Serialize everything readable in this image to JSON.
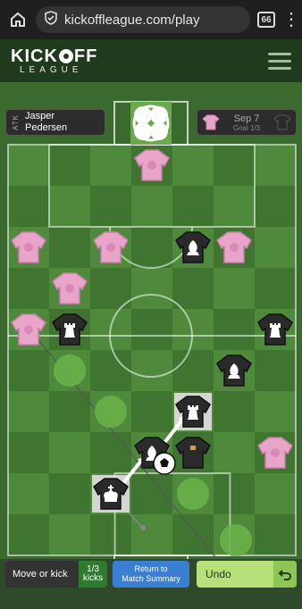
{
  "browser": {
    "url": "kickoffleague.com/play",
    "tab_count": "66"
  },
  "header": {
    "logo_main_a": "KICK",
    "logo_main_b": "FF",
    "logo_sub": "LEAGUE"
  },
  "match": {
    "attacker_tag": "ATK",
    "player_name_line1": "Jasper",
    "player_name_line2": "Pedersen",
    "date": "Sep 7",
    "goal_progress": "Goal 1/3"
  },
  "controls": {
    "move_label": "Move or kick",
    "kick_count": "1/3",
    "kick_unit": "kicks",
    "summary_line1": "Return to",
    "summary_line2": "Match Summary",
    "undo_label": "Undo"
  },
  "colors": {
    "pink_team": "#e8a5c9",
    "black_team": "#2a2a2a",
    "pitch_light": "#4f8a3c",
    "pitch_dark": "#3f7530",
    "accent_green": "#b5e07a",
    "summary_blue": "#3a7fd1"
  },
  "pieces": [
    {
      "team": "pink",
      "col": 3,
      "row": 0
    },
    {
      "team": "pink",
      "col": 0,
      "row": 2
    },
    {
      "team": "pink",
      "col": 2,
      "row": 2
    },
    {
      "team": "black",
      "col": 4,
      "row": 2,
      "icon": "bishop"
    },
    {
      "team": "pink",
      "col": 5,
      "row": 2
    },
    {
      "team": "pink",
      "col": 1,
      "row": 3
    },
    {
      "team": "pink",
      "col": 0,
      "row": 4
    },
    {
      "team": "black",
      "col": 1,
      "row": 4,
      "icon": "rook"
    },
    {
      "team": "black",
      "col": 6,
      "row": 4,
      "icon": "rook"
    },
    {
      "team": "black",
      "col": 5,
      "row": 5,
      "icon": "bishop"
    },
    {
      "team": "black",
      "col": 4,
      "row": 6,
      "icon": "rook",
      "selected": true
    },
    {
      "team": "black",
      "col": 3,
      "row": 7,
      "icon": "bishop"
    },
    {
      "team": "black",
      "col": 4,
      "row": 7,
      "icon": "none"
    },
    {
      "team": "pink",
      "col": 6,
      "row": 7
    },
    {
      "team": "black",
      "col": 2,
      "row": 8,
      "icon": "king",
      "selected": true
    }
  ]
}
